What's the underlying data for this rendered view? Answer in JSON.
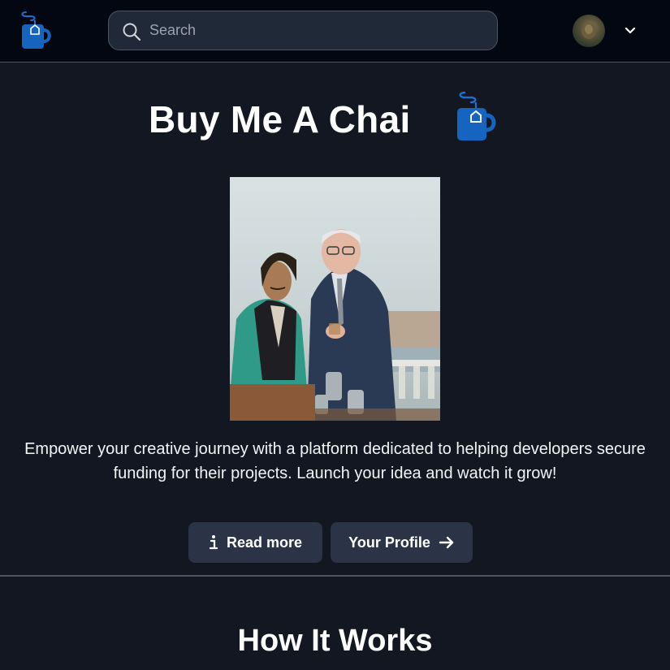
{
  "navbar": {
    "logo_icon": "chai-cup-icon",
    "search": {
      "placeholder": "Search",
      "value": "",
      "icon": "search-icon"
    },
    "avatar_icon": "avatar",
    "menu_icon": "chevron-down-icon"
  },
  "hero": {
    "title": "Buy Me A Chai",
    "logo_icon": "chai-cup-icon",
    "image_icon": "hero-photo",
    "tagline": "Empower your creative journey with a platform dedicated to helping developers secure funding for their projects. Launch your idea and watch it grow!",
    "buttons": {
      "read_more": {
        "label": "Read more",
        "icon": "info-icon"
      },
      "your_profile": {
        "label": "Your Profile",
        "icon": "arrow-right-icon"
      }
    }
  },
  "how_it_works": {
    "title": "How It Works"
  },
  "colors": {
    "background": "#131722",
    "navbar": "#030712",
    "button": "#2a3446",
    "logo_blue": "#1565c0",
    "text": "#ffffff"
  }
}
